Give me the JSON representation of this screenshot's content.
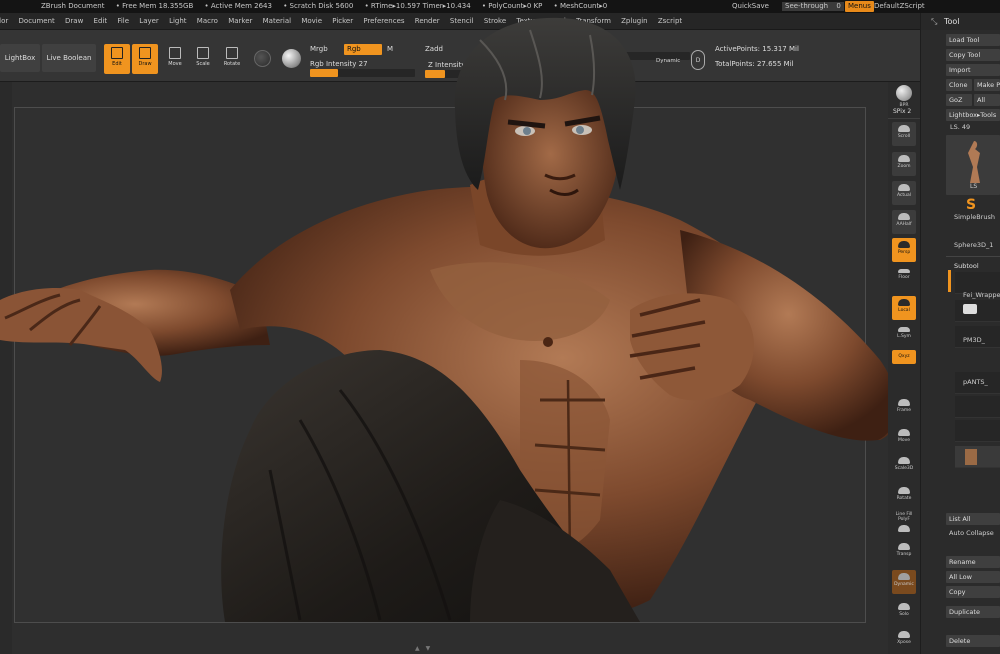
{
  "statusbar": {
    "doc": "ZBrush Document",
    "free_mem": "• Free Mem 18.355GB",
    "active_mem": "• Active Mem 2643",
    "scratch": "• Scratch Disk 5600",
    "rtime": "• RTime▸10.597 Timer▸10.434",
    "polycount": "• PolyCount▸0 KP",
    "meshcount": "• MeshCount▸0",
    "quicksave": "QuickSave",
    "see_through": "See-through",
    "see_through_value": "0",
    "menus": "Menus",
    "zscript": "DefaultZScript"
  },
  "menubar": [
    "Color",
    "Document",
    "Draw",
    "Edit",
    "File",
    "Layer",
    "Light",
    "Macro",
    "Marker",
    "Material",
    "Movie",
    "Picker",
    "Preferences",
    "Render",
    "Stencil",
    "Stroke",
    "Texture",
    "Tool",
    "Transform",
    "Zplugin",
    "Zscript"
  ],
  "topshelf": {
    "lightbox": "LightBox",
    "live_boolean": "Live Boolean",
    "tools": [
      {
        "label": "Edit",
        "active": true
      },
      {
        "label": "Draw",
        "active": true
      },
      {
        "label": "Move",
        "active": false
      },
      {
        "label": "Scale",
        "active": false
      },
      {
        "label": "Rotate",
        "active": false
      }
    ],
    "mrgb": "Mrgb",
    "rgb": "Rgb",
    "m": "M",
    "rgb_intensity": "Rgb Intensity 27",
    "rgb_intensity_fraction": 0.27,
    "zadd": "Zadd",
    "z_intensity": "Z Intensity",
    "dynamic": "Dynamic",
    "active_points": "ActivePoints: 15.317 Mil",
    "total_points": "TotalPoints: 27.655 Mil"
  },
  "rightdock": [
    {
      "label": "BPR",
      "active": false
    },
    {
      "label": "SPix 2",
      "active": false
    },
    {
      "label": "Scroll",
      "active": false
    },
    {
      "label": "Zoom",
      "active": false
    },
    {
      "label": "Actual",
      "active": false
    },
    {
      "label": "AAHalf",
      "active": false
    },
    {
      "label": "Persp",
      "active": true
    },
    {
      "label": "Floor",
      "active": false
    },
    {
      "label": "Local",
      "active": true
    },
    {
      "label": "L.Sym",
      "active": false
    },
    {
      "label": "Qxyz",
      "active": true
    },
    {
      "label": "Frame",
      "active": false
    },
    {
      "label": "Move",
      "active": false
    },
    {
      "label": "Scale3D",
      "active": false
    },
    {
      "label": "Rotate",
      "active": false
    },
    {
      "label": "Line Fill PolyF",
      "active": false
    },
    {
      "label": "Transp",
      "active": false
    },
    {
      "label": "Dynamic",
      "active": false
    },
    {
      "label": "Solo",
      "active": false
    },
    {
      "label": "Xpose",
      "active": false
    }
  ],
  "toolpanel": {
    "title": "Tool",
    "load_tool": "Load Tool",
    "copy_tool": "Copy Tool",
    "import": "Import",
    "clone": "Clone",
    "make": "Make P",
    "goz": "GoZ",
    "all": "All",
    "lightbox_tools": "Lightbox▸Tools",
    "ls": "LS. 49",
    "thumb_label": "LS",
    "simplebrush": "SimpleBrush",
    "sphere": "Sphere3D_1",
    "subtool": "Subtool",
    "subtools": [
      "Fei_Wrappe",
      "PM3D_",
      "pANTS_"
    ],
    "list_all": "List All",
    "auto_collapse": "Auto Collapse",
    "rename": "Rename",
    "all_low": "All Low",
    "copy": "Copy",
    "duplicate": "Duplicate",
    "delete": "Delete"
  },
  "colors": {
    "accent": "#f0941f",
    "panel": "#353535",
    "background": "#2e2e2e"
  }
}
